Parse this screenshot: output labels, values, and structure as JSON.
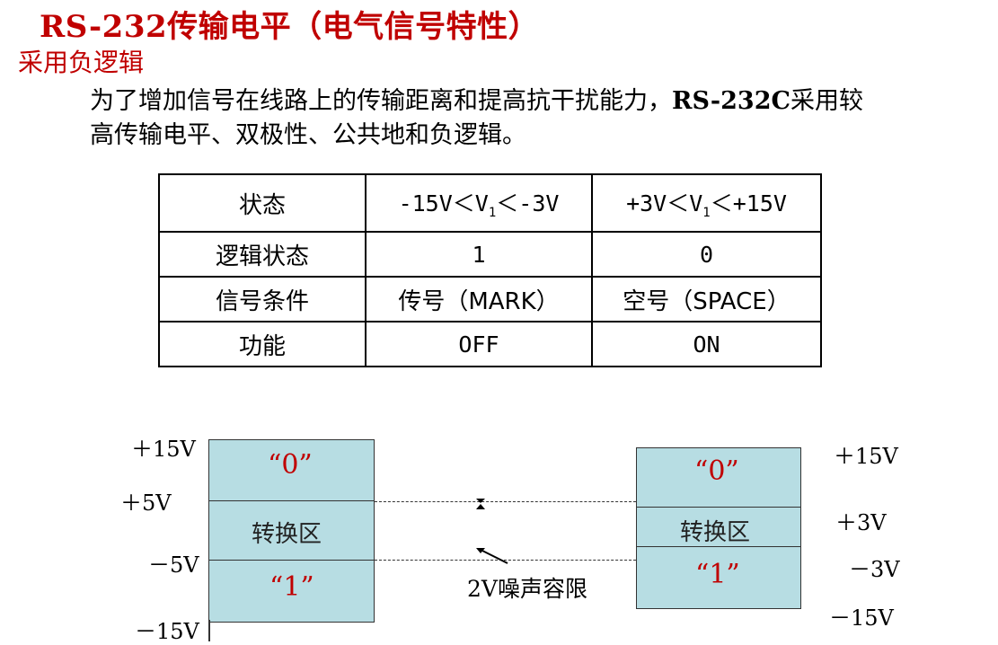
{
  "title": "RS-232传输电平（电气信号特性）",
  "subtitle": "采用负逻辑",
  "paragraph": {
    "line1_a": "为了增加信号在线路上的传输距离和提高抗干扰能力，",
    "line1_b": "RS-232C",
    "line1_c": "采用较",
    "line2": "高传输电平、双极性、公共地和负逻辑。"
  },
  "table": {
    "header": {
      "c0": "状态",
      "c1_pre": "-15V＜V",
      "c1_sub": "1",
      "c1_post": "＜-3V",
      "c2_pre": "+3V＜V",
      "c2_sub": "1",
      "c2_post": "＜+15V"
    },
    "rows": [
      {
        "c0": "逻辑状态",
        "c1": "1",
        "c2": "0"
      },
      {
        "c0": "信号条件",
        "c1": "传号（MARK）",
        "c2": "空号（SPACE）"
      },
      {
        "c0": "功能",
        "c1": "OFF",
        "c2": "ON"
      }
    ]
  },
  "diagram": {
    "left": {
      "labels": [
        "＋15V",
        "＋5V",
        "－5V",
        "－15V"
      ],
      "zone0": "“0”",
      "zone_mid": "转换区",
      "zone1": "“1”"
    },
    "right": {
      "labels": [
        "＋15V",
        "＋3V",
        "－3V",
        "－15V"
      ],
      "zone0": "“0”",
      "zone_mid": "转换区",
      "zone1": "“1”"
    },
    "noise_margin": "2V噪声容限"
  },
  "colors": {
    "red_text": "#c00000",
    "box_fill": "#b7dde3"
  }
}
